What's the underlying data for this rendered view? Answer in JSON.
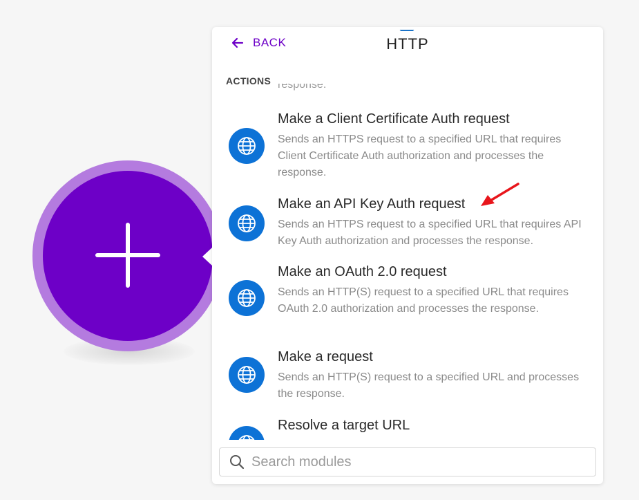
{
  "panel": {
    "back_label": "BACK",
    "title": "HTTP",
    "section_label": "ACTIONS",
    "cut_text": "response."
  },
  "actions": [
    {
      "title": "Make a Client Certificate Auth request",
      "description": "Sends an HTTPS request to a specified URL that requires Client Certificate Auth authorization and processes the response.",
      "icon": "globe-icon"
    },
    {
      "title": "Make an API Key Auth request",
      "description": "Sends an HTTPS request to a specified URL that requires API Key Auth authorization and processes the response.",
      "icon": "globe-icon"
    },
    {
      "title": "Make an OAuth 2.0 request",
      "description": "Sends an HTTP(S) request to a specified URL that requires OAuth 2.0 authorization and processes the response.",
      "icon": "globe-icon"
    },
    {
      "title": "Make a request",
      "description": "Sends an HTTP(S) request to a specified URL and processes the response.",
      "icon": "globe-icon"
    },
    {
      "title": "Resolve a target URL",
      "description": "",
      "icon": "globe-icon"
    }
  ],
  "search": {
    "placeholder": "Search modules",
    "value": ""
  },
  "colors": {
    "accent": "#6d00c7",
    "module_ring": "#b47bdf",
    "app_icon": "#0d72d6",
    "annotation": "#e8151b"
  }
}
